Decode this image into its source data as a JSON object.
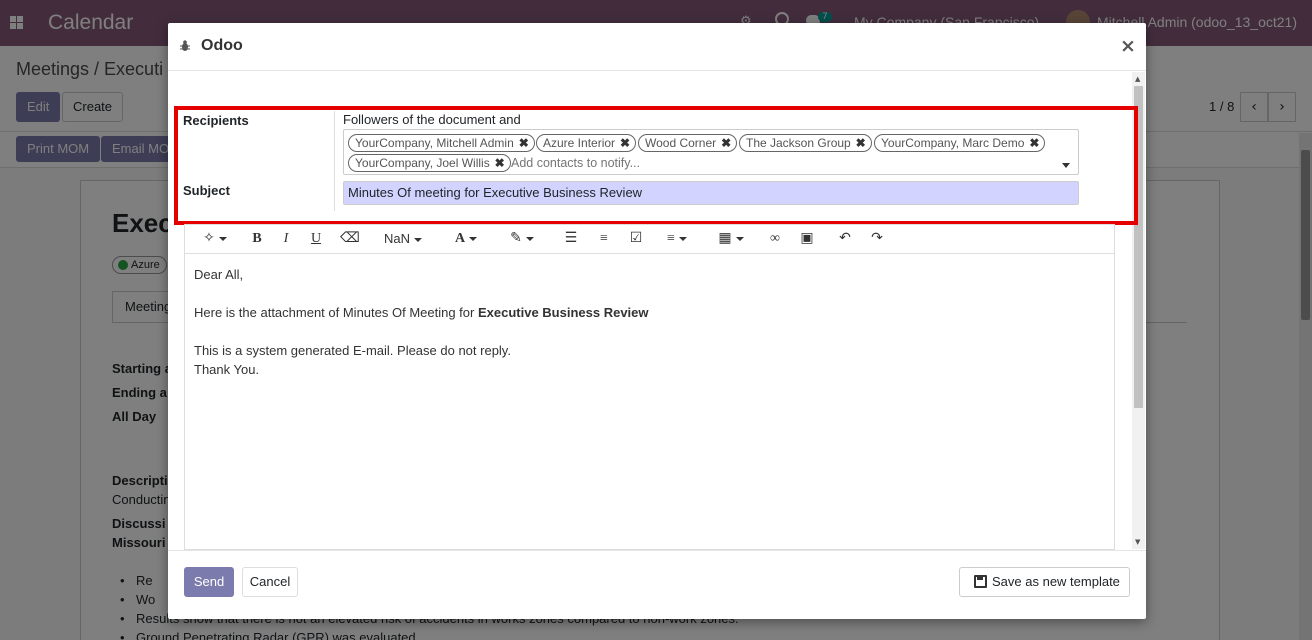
{
  "app": {
    "title": "Calendar",
    "nav": {
      "chat_badge": "7",
      "company": "My Company (San Francisco)",
      "user": "Mitchell Admin (odoo_13_oct21)"
    }
  },
  "background": {
    "breadcrumb": "Meetings / Executi",
    "buttons": {
      "edit": "Edit",
      "create": "Create",
      "print_mom": "Print MOM",
      "email_mom": "Email MO"
    },
    "pager": "1 / 8",
    "record_title": "Exec",
    "tag": "Azure",
    "tab": "Meeting",
    "fields": {
      "starting": "Starting a",
      "ending": "Ending a",
      "all_day": "All Day"
    },
    "description_label": "Descripti",
    "description_text": "Conductin",
    "discussion_label": "Discussi",
    "discussion_bold": "Missouri",
    "bullets": [
      "Re",
      "Wo",
      "Results show that there is not an elevated risk of accidents in works zones compared to non-work zones.",
      "Ground Penetrating Radar (GPR) was evaluated"
    ]
  },
  "modal": {
    "title": "Odoo",
    "recipients_label": "Recipients",
    "followers_text": "Followers of the document and",
    "recipients": [
      "YourCompany, Mitchell Admin",
      "Azure Interior",
      "Wood Corner",
      "The Jackson Group",
      "YourCompany, Marc Demo",
      "YourCompany, Joel Willis"
    ],
    "recipients_placeholder": "Add contacts to notify...",
    "subject_label": "Subject",
    "subject_value": "Minutes Of meeting for Executive Business Review",
    "toolbar": {
      "font_size": "NaN"
    },
    "body": {
      "greeting": "Dear All,",
      "attachment_prefix": "Here is the attachment of Minutes Of Meeting for ",
      "attachment_bold": "Executive Business Review",
      "system_note": "This is a system generated E-mail. Please do not reply.",
      "thanks": "Thank You."
    },
    "footer": {
      "send": "Send",
      "cancel": "Cancel",
      "save_template": "Save as new template"
    }
  },
  "colors": {
    "nav_bg": "#875a7b",
    "primary": "#7c7bad",
    "highlight": "#e50000",
    "subject_bg": "#d3d3ff"
  }
}
